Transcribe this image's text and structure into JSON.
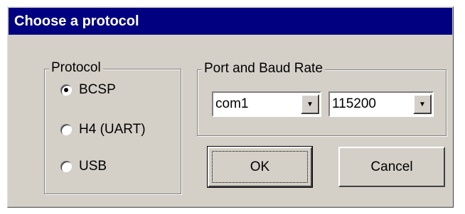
{
  "dialog": {
    "title": "Choose a protocol"
  },
  "protocol": {
    "group_label": "Protocol",
    "options": [
      {
        "label": "BCSP",
        "selected": true
      },
      {
        "label": "H4 (UART)",
        "selected": false
      },
      {
        "label": "USB",
        "selected": false
      }
    ]
  },
  "port": {
    "group_label": "Port and Baud Rate",
    "port_value": "com1",
    "baud_value": "115200",
    "arrow_icon": "▼"
  },
  "buttons": {
    "ok": "OK",
    "cancel": "Cancel"
  }
}
